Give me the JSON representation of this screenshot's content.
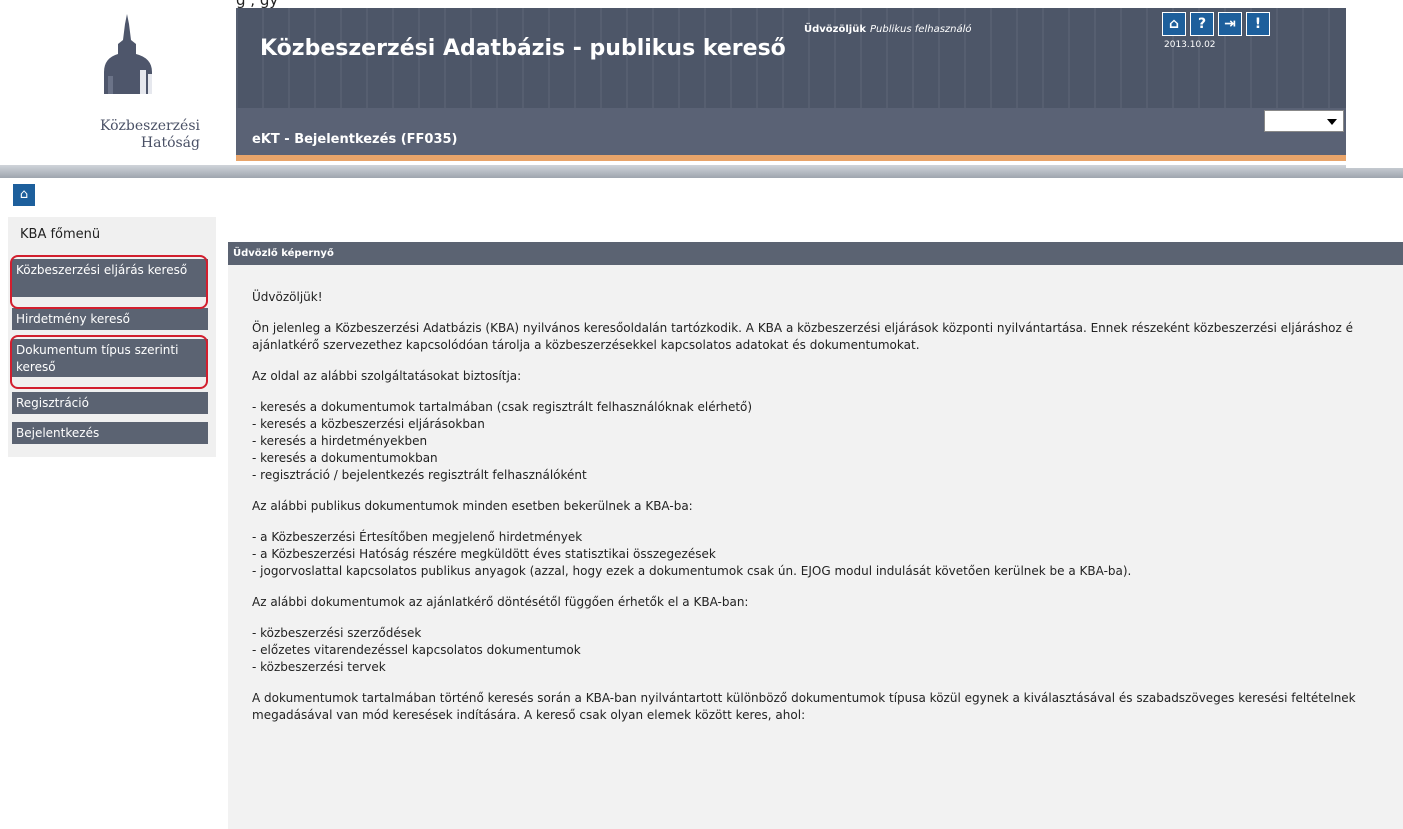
{
  "top_cut_text": "g                                                                           ,          gy",
  "logo": {
    "line1": "Közbeszerzési",
    "line2": "Hatóság"
  },
  "header": {
    "title": "Közbeszerzési Adatbázis - publikus kereső",
    "welcome_bold": "Üdvözöljük",
    "welcome_user": "Publikus felhasználó",
    "subtitle": "eKT - Bejelentkezés (FF035)",
    "date": "2013.10.02",
    "icons": [
      "home-icon",
      "help-icon",
      "logout-icon",
      "alert-icon"
    ],
    "icon_glyphs": {
      "home": "⌂",
      "help": "?",
      "logout": "⇥",
      "alert": "!"
    },
    "dropdown_value": ""
  },
  "sidebar": {
    "title": "KBA főmenü",
    "items": [
      {
        "label": "Közbeszerzési eljárás kereső"
      },
      {
        "label": "Hirdetmény kereső"
      },
      {
        "label": "Dokumentum típus szerinti kereső"
      },
      {
        "label": "Regisztráció"
      },
      {
        "label": "Bejelentkezés"
      }
    ]
  },
  "panel": {
    "title": "Üdvözlő képernyő",
    "greeting": "Üdvözöljük!",
    "intro_1": "Ön jelenleg a Közbeszerzési Adatbázis (KBA) nyilvános keresőoldalán tartózkodik. A KBA a közbeszerzési eljárások központi nyilvántartása. Ennek részeként közbeszerzési eljáráshoz é",
    "intro_2": "ajánlatkérő szervezethez kapcsolódóan tárolja a közbeszerzésekkel kapcsolatos adatokat és dokumentumokat.",
    "services_title": "Az oldal az alábbi szolgáltatásokat biztosítja:",
    "services": [
      "- keresés a dokumentumok tartalmában (csak regisztrált felhasználóknak elérhető)",
      "- keresés a közbeszerzési eljárásokban",
      "- keresés a hirdetményekben",
      "- keresés a dokumentumokban",
      "- regisztráció / bejelentkezés regisztrált felhasználóként"
    ],
    "public_title": "Az alábbi publikus dokumentumok minden esetben bekerülnek a KBA-ba:",
    "public": [
      "- a Közbeszerzési Értesítőben megjelenő hirdetmények",
      "- a Közbeszerzési Hatóság részére megküldött éves statisztikai összegezések",
      "- jogorvoslattal kapcsolatos publikus anyagok (azzal, hogy ezek a dokumentumok csak ún. EJOG modul indulását követően kerülnek be a KBA-ba)."
    ],
    "optional_title": "Az alábbi dokumentumok az ajánlatkérő döntésétől függően érhetők el a KBA-ban:",
    "optional": [
      "- közbeszerzési szerződések",
      "- előzetes vitarendezéssel kapcsolatos dokumentumok",
      "- közbeszerzési tervek"
    ],
    "search_1": "A dokumentumok tartalmában történő keresés során a KBA-ban nyilvántartott különböző dokumentumok típusa közül egynek a kiválasztásával és szabadszöveges keresési feltételnek",
    "search_2": "megadásával van mód keresések indítására. A kereső csak olyan elemek között keres, ahol:"
  },
  "colors": {
    "banner": "#4d5668",
    "accent": "#e8a46a",
    "menu": "#5b6372",
    "highlight": "#d21e2e"
  }
}
